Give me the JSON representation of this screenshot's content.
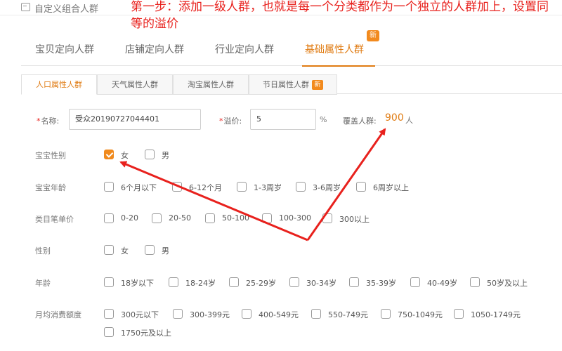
{
  "topbar": {
    "title": "自定义组合人群",
    "icon": "home-icon"
  },
  "annotation": "第一步：添加一级人群，也就是每一个分类都作为一个独立的人群加上，设置同等的溢价",
  "main_tabs": [
    {
      "label": "宝贝定向人群",
      "active": false
    },
    {
      "label": "店铺定向人群",
      "active": false
    },
    {
      "label": "行业定向人群",
      "active": false
    },
    {
      "label": "基础属性人群",
      "active": true
    }
  ],
  "main_tab_badge": "新",
  "sub_tabs": [
    {
      "label": "人口属性人群",
      "active": true
    },
    {
      "label": "天气属性人群",
      "active": false
    },
    {
      "label": "淘宝属性人群",
      "active": false
    },
    {
      "label": "节日属性人群",
      "active": false,
      "badge": "新"
    }
  ],
  "form": {
    "name_label": "名称:",
    "name_value": "受众20190727044401",
    "premium_label": "溢价:",
    "premium_value": "5",
    "premium_unit": "%",
    "coverage_label": "覆盖人群:",
    "coverage_value": "900",
    "coverage_unit": "人"
  },
  "rows": [
    {
      "label": "宝宝性别",
      "options": [
        {
          "label": "女",
          "checked": true
        },
        {
          "label": "男",
          "checked": false
        }
      ]
    },
    {
      "label": "宝宝年龄",
      "options": [
        {
          "label": "6个月以下",
          "checked": false
        },
        {
          "label": "6-12个月",
          "checked": false
        },
        {
          "label": "1-3周岁",
          "checked": false
        },
        {
          "label": "3-6周岁",
          "checked": false
        },
        {
          "label": "6周岁以上",
          "checked": false
        }
      ]
    },
    {
      "label": "类目笔单价",
      "options": [
        {
          "label": "0-20",
          "checked": false
        },
        {
          "label": "20-50",
          "checked": false
        },
        {
          "label": "50-100",
          "checked": false
        },
        {
          "label": "100-300",
          "checked": false
        },
        {
          "label": "300以上",
          "checked": false
        }
      ]
    },
    {
      "label": "性别",
      "options": [
        {
          "label": "女",
          "checked": false
        },
        {
          "label": "男",
          "checked": false
        }
      ]
    },
    {
      "label": "年龄",
      "options": [
        {
          "label": "18岁以下",
          "checked": false
        },
        {
          "label": "18-24岁",
          "checked": false
        },
        {
          "label": "25-29岁",
          "checked": false
        },
        {
          "label": "30-34岁",
          "checked": false
        },
        {
          "label": "35-39岁",
          "checked": false
        },
        {
          "label": "40-49岁",
          "checked": false
        },
        {
          "label": "50岁及以上",
          "checked": false
        }
      ]
    },
    {
      "label": "月均消费额度",
      "options": [
        {
          "label": "300元以下",
          "checked": false
        },
        {
          "label": "300-399元",
          "checked": false
        },
        {
          "label": "400-549元",
          "checked": false
        },
        {
          "label": "550-749元",
          "checked": false
        },
        {
          "label": "750-1049元",
          "checked": false
        },
        {
          "label": "1050-1749元",
          "checked": false
        },
        {
          "label": "1750元及以上",
          "checked": false
        }
      ]
    }
  ],
  "colors": {
    "accent": "#e07b12",
    "annotation": "#e8211d",
    "checked": "#f08a1d"
  }
}
